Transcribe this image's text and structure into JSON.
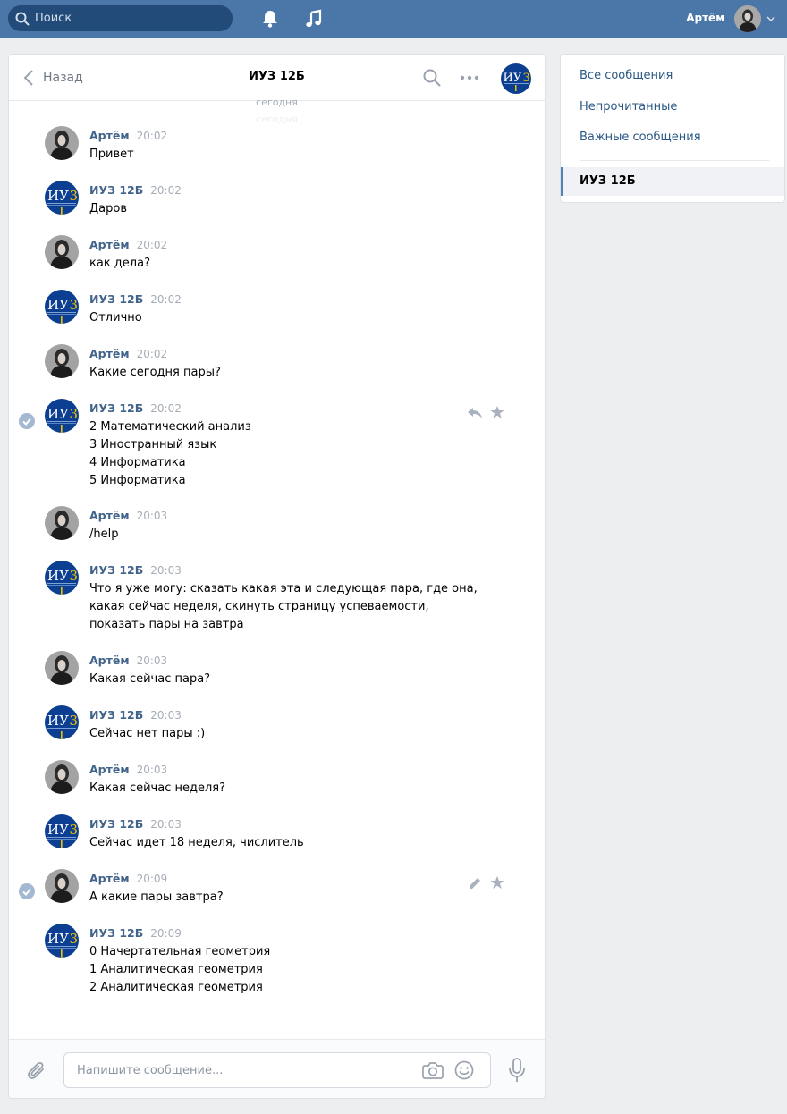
{
  "topbar": {
    "search_placeholder": "Поиск",
    "user_name": "Артём"
  },
  "chat": {
    "back_label": "Назад",
    "title": "ИУЗ 12Б",
    "day_label": "сегодня",
    "input_placeholder": "Напишите сообщение..."
  },
  "messages": [
    {
      "author": "Артём",
      "time": "20:02",
      "text": "Привет"
    },
    {
      "author": "ИУЗ 12Б",
      "time": "20:02",
      "text": "Даров"
    },
    {
      "author": "Артём",
      "time": "20:02",
      "text": "как дела?"
    },
    {
      "author": "ИУЗ 12Б",
      "time": "20:02",
      "text": "Отлично"
    },
    {
      "author": "Артём",
      "time": "20:02",
      "text": "Какие сегодня пары?"
    },
    {
      "author": "ИУЗ 12Б",
      "time": "20:02",
      "lines": [
        "2 Математический анализ",
        "3 Иностранный язык",
        "4 Информатика",
        "5 Информатика"
      ]
    },
    {
      "author": "Артём",
      "time": "20:03",
      "text": "/help"
    },
    {
      "author": "ИУЗ 12Б",
      "time": "20:03",
      "lines": [
        "Что я уже могу: сказать какая эта и следующая пара, где она,",
        "какая сейчас неделя, скинуть страницу успеваемости,",
        "показать пары на завтра"
      ]
    },
    {
      "author": "Артём",
      "time": "20:03",
      "text": "Какая сейчас пара?"
    },
    {
      "author": "ИУЗ 12Б",
      "time": "20:03",
      "text": "Сейчас нет пары :)"
    },
    {
      "author": "Артём",
      "time": "20:03",
      "text": "Какая сейчас неделя?"
    },
    {
      "author": "ИУЗ 12Б",
      "time": "20:03",
      "text": "Сейчас идет 18 неделя, числитель"
    },
    {
      "author": "Артём",
      "time": "20:09",
      "text": "А какие пары завтра?"
    },
    {
      "author": "ИУЗ 12Б",
      "time": "20:09",
      "lines": [
        "0 Начертательная геометрия",
        "1 Аналитическая геометрия",
        "2 Аналитическая геометрия"
      ]
    }
  ],
  "sidebar": {
    "items": [
      {
        "label": "Все сообщения"
      },
      {
        "label": "Непрочитанные"
      },
      {
        "label": "Важные сообщения"
      },
      {
        "label": "ИУЗ 12Б"
      }
    ]
  },
  "colors": {
    "topbar": "#4a76a8",
    "link": "#2a5885",
    "author": "#42648b",
    "group_avatar": "#0c3f91"
  },
  "icons": [
    "search-icon",
    "bell-icon",
    "music-icon",
    "chevron-down-icon",
    "back-arrow-icon",
    "more-icon",
    "read-check-icon",
    "reply-icon",
    "star-icon",
    "edit-icon",
    "attach-icon",
    "camera-icon",
    "smile-icon",
    "mic-icon"
  ]
}
